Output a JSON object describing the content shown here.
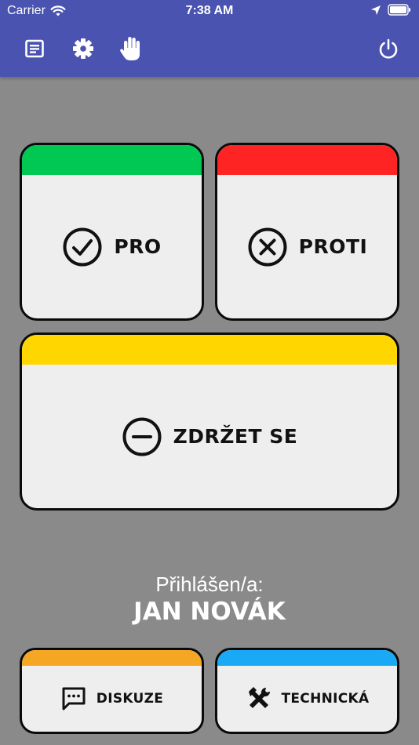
{
  "status_bar": {
    "carrier": "Carrier",
    "time": "7:38 AM"
  },
  "toolbar": {
    "icons": [
      "document-icon",
      "gear-icon",
      "raise-hand-icon",
      "power-icon"
    ]
  },
  "votes": {
    "pro": {
      "label": "PRO",
      "color": "#00c853"
    },
    "proti": {
      "label": "PROTI",
      "color": "#ff2424"
    },
    "zdrzet": {
      "label": "ZDRŽET SE",
      "color": "#ffd600"
    }
  },
  "login": {
    "caption": "Přihlášen/a:",
    "name": "JAN NOVÁK"
  },
  "actions": {
    "diskuze": {
      "label": "DISKUZE",
      "color": "#f5a623"
    },
    "technicka": {
      "label": "TECHNICKÁ",
      "color": "#1aa9f5"
    }
  },
  "colors": {
    "header": "#4a54b0",
    "background": "#8a8a8a",
    "card": "#eeeeee"
  }
}
